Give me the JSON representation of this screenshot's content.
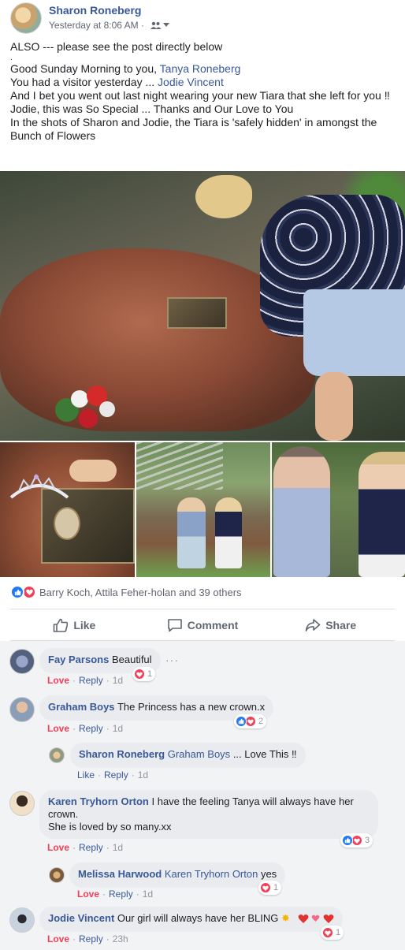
{
  "post": {
    "author": "Sharon Roneberg",
    "timestamp": "Yesterday at 8:06 AM ·",
    "text": {
      "line1": "ALSO --- please see the post directly below",
      "line2": ".",
      "line3_prefix": "Good Sunday Morning to you, ",
      "line3_link": "Tanya Roneberg",
      "line4_prefix": "You had a visitor yesterday ... ",
      "line4_link": "Jodie Vincent",
      "line5": "And I bet you went out last night wearing your new Tiara that she left for you ‼",
      "line6": "Jodie, this was So Special ... Thanks and Our Love to You",
      "line7": "In the shots of Sharon and Jodie, the Tiara is 'safely hidden' in amongst the Bunch of Flowers"
    },
    "reactions_summary": "Barry Koch, Attila Feher-holan and 39 others"
  },
  "actions": {
    "like": "Like",
    "comment": "Comment",
    "share": "Share"
  },
  "comments": [
    {
      "name": "Fay Parsons",
      "text": "Beautiful",
      "reaction_label": "Love",
      "reply": "Reply",
      "time": "1d",
      "count": "1",
      "more": "···"
    },
    {
      "name": "Graham Boys",
      "text": "The Princess has a new crown.x",
      "reaction_label": "Love",
      "reply": "Reply",
      "time": "1d",
      "count": "2"
    },
    {
      "name": "Sharon Roneberg",
      "mention": "Graham Boys",
      "text": "... Love This ‼",
      "reaction_label": "Like",
      "reply": "Reply",
      "time": "1d"
    },
    {
      "name": "Karen Tryhorn Orton",
      "text": "I have the feeling Tanya will always have her crown.",
      "text2": "She is loved by so many.xx",
      "reaction_label": "Love",
      "reply": "Reply",
      "time": "1d",
      "count": "3"
    },
    {
      "name": "Melissa Harwood",
      "mention": "Karen Tryhorn Orton",
      "text": "yes",
      "reaction_label": "Love",
      "reply": "Reply",
      "time": "1d",
      "count": "1"
    },
    {
      "name": "Jodie Vincent",
      "text": "Our girl will always have her BLING",
      "reaction_label": "Love",
      "reply": "Reply",
      "time": "23h",
      "count": "1"
    }
  ],
  "colors": {
    "link": "#385898",
    "love": "#f33e58",
    "like": "#2078f4",
    "comment_bg": "#f2f3f5",
    "bubble_bg": "#e9ebee"
  },
  "icons": [
    "people-icon",
    "chevron-down-icon",
    "like-reaction-icon",
    "love-reaction-icon",
    "thumbs-up-icon",
    "comment-icon",
    "share-icon",
    "heart-emoji-icon",
    "sparkle-emoji-icon"
  ]
}
